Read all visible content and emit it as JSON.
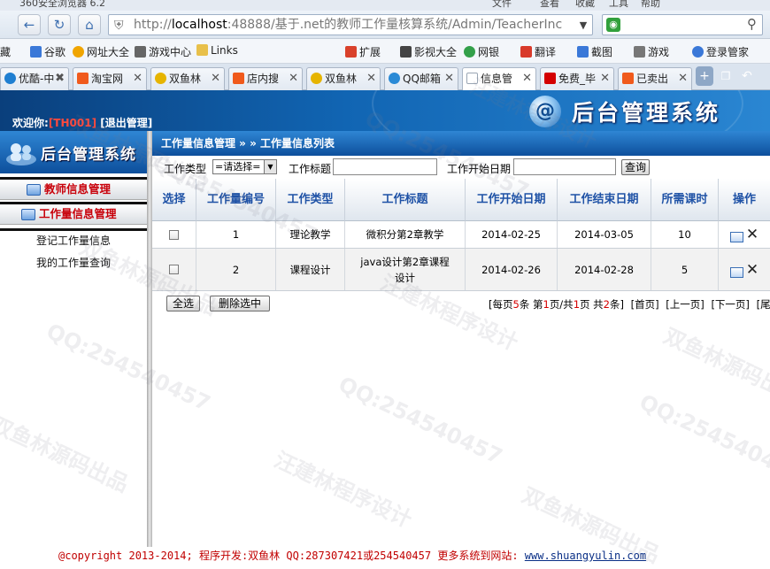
{
  "browser": {
    "window_title": "360安全浏览器 6.2",
    "menu": [
      "文件",
      "查看",
      "收藏",
      "工具",
      "帮助"
    ],
    "address": {
      "prefix": "http://",
      "host": "localhost",
      "rest": ":48888/基于.net的教师工作量核算系统/Admin/TeacherInc"
    },
    "bookmarks": [
      {
        "label": "藏",
        "color": "#777777"
      },
      {
        "label": "谷歌",
        "color": "#3a78d8"
      },
      {
        "label": "网址大全",
        "color": "#f0a500"
      },
      {
        "label": "游戏中心",
        "color": "#666666"
      },
      {
        "label": "Links",
        "color": "#e8c04a"
      },
      {
        "label": "扩展",
        "color": "#d9412b"
      },
      {
        "label": "影视大全",
        "color": "#444444"
      },
      {
        "label": "网银",
        "color": "#33a04a"
      },
      {
        "label": "翻译",
        "color": "#d83a2a"
      },
      {
        "label": "截图",
        "color": "#3a78d8"
      },
      {
        "label": "游戏",
        "color": "#777777"
      },
      {
        "label": "登录管家",
        "color": "#3a78d8"
      }
    ],
    "tabs": [
      {
        "label": "优酷-中",
        "color": "#1f7fd1",
        "active": false
      },
      {
        "label": "淘宝网",
        "color": "#f05a1c",
        "active": false
      },
      {
        "label": "双鱼林",
        "color": "#e6b400",
        "active": false
      },
      {
        "label": "店内搜",
        "color": "#f05a1c",
        "active": false
      },
      {
        "label": "双鱼林",
        "color": "#e6b400",
        "active": false
      },
      {
        "label": "QQ邮箱",
        "color": "#2a8ad6",
        "active": false
      },
      {
        "label": "信息管",
        "color": "#9aa6b4",
        "active": true
      },
      {
        "label": "免费_毕",
        "color": "#d40000",
        "active": false
      },
      {
        "label": "已卖出",
        "color": "#f05a1c",
        "active": false
      }
    ]
  },
  "header": {
    "welcome_label": "欢迎你:",
    "user_id": "[TH001]",
    "logout_label": "[退出管理]",
    "title": "后台管理系统",
    "logo_char": "@"
  },
  "sidebar": {
    "title": "后台管理系统",
    "sections": [
      {
        "label": "教师信息管理"
      },
      {
        "label": "工作量信息管理"
      }
    ],
    "items": [
      {
        "label": "登记工作量信息"
      },
      {
        "label": "我的工作量查询"
      }
    ]
  },
  "main": {
    "breadcrumb": "工作量信息管理 » » 工作量信息列表",
    "filters": {
      "type_label": "工作类型",
      "type_value": "=请选择=",
      "title_label": "工作标题",
      "title_value": "",
      "start_label": "工作开始日期",
      "start_value": "",
      "search_label": "查询"
    },
    "table": {
      "columns": [
        "选择",
        "工作量编号",
        "工作类型",
        "工作标题",
        "工作开始日期",
        "工作结束日期",
        "所需课时",
        "操作"
      ],
      "rows": [
        {
          "id": "1",
          "type": "理论教学",
          "title": "微积分第2章教学",
          "start": "2014-02-25",
          "end": "2014-03-05",
          "hours": "10"
        },
        {
          "id": "2",
          "type": "课程设计",
          "title": "java设计第2章课程设计",
          "start": "2014-02-26",
          "end": "2014-02-28",
          "hours": "5"
        }
      ]
    },
    "select_all_label": "全选",
    "delete_selected_label": "删除选中",
    "pager": {
      "per_page_prefix": "[每页",
      "per_page": "5",
      "per_page_suffix": "条 第",
      "page": "1",
      "page_mid": "页/共",
      "pages": "1",
      "pages_suffix": "页 共",
      "total": "2",
      "total_suffix": "条]",
      "first": "[首页]",
      "prev": "[上一页]",
      "next": "[下一页]",
      "last": "[尾页]"
    }
  },
  "footer": {
    "text": "@copyright 2013-2014; 程序开发:双鱼林  QQ:287307421或254540457  更多系统到网站:",
    "link": "www.shuangyulin.com"
  },
  "watermark": {
    "lines": [
      "QQ:254540457",
      "汪建林程序设计",
      "双鱼林源码出品"
    ]
  }
}
